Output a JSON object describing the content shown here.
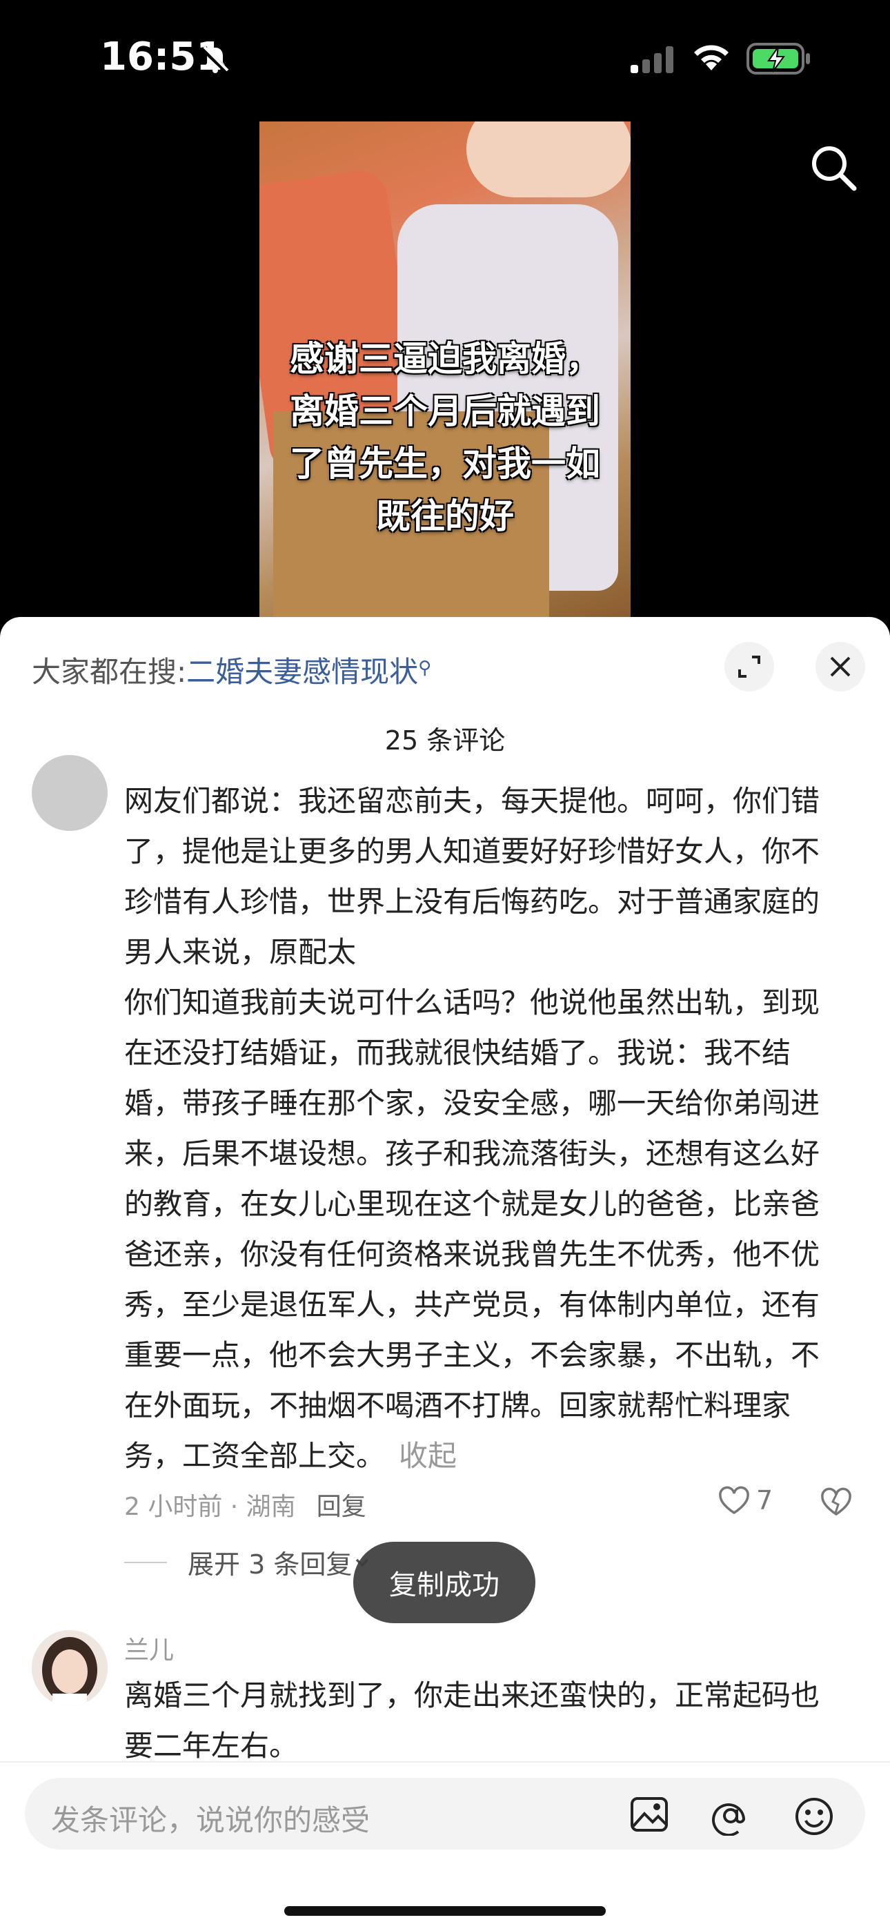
{
  "status_bar": {
    "time": "16:51"
  },
  "video": {
    "caption": [
      "感谢三逼迫我离婚，",
      "离婚三个月后就遇到",
      "了曾先生，对我一如",
      "既往的好"
    ]
  },
  "sheet": {
    "hot_prefix": "大家都在搜:",
    "hot_query": "二婚夫妻感情现状",
    "comment_count": "25 条评论"
  },
  "comment1": {
    "lines": [
      "网友们都说：我还留恋前夫，每天提他。呵呵，你们错",
      "了，提他是让更多的男人知道要好好珍惜好女人，你不",
      "珍惜有人珍惜，世界上没有后悔药吃。对于普通家庭的",
      "男人来说，原配太",
      "你们知道我前夫说可什么话吗？他说他虽然出轨，到现",
      "在还没打结婚证，而我就很快结婚了。我说：我不结",
      "婚，带孩子睡在那个家，没安全感，哪一天给你弟闯进",
      "来，后果不堪设想。孩子和我流落街头，还想有这么好",
      "的教育，在女儿心里现在这个就是女儿的爸爸，比亲爸",
      "爸还亲，你没有任何资格来说我曾先生不优秀，他不优",
      "秀，至少是退伍军人，共产党员，有体制内单位，还有",
      "重要一点，他不会大男子主义，不会家暴，不出轨，不",
      "在外面玩，不抽烟不喝酒不打牌。回家就帮忙料理家",
      "务，工资全部上交。"
    ],
    "fold": "收起",
    "meta": "2 小时前 · 湖南",
    "reply": "回复",
    "likes": "7",
    "expand": "展开 3 条回复"
  },
  "toast": "复制成功",
  "comment2": {
    "user": "兰儿",
    "lines": [
      "离婚三个月就找到了，你走出来还蛮快的，正常起码也",
      "要二年左右。"
    ]
  },
  "input": {
    "placeholder": "发条评论，说说你的感受"
  }
}
